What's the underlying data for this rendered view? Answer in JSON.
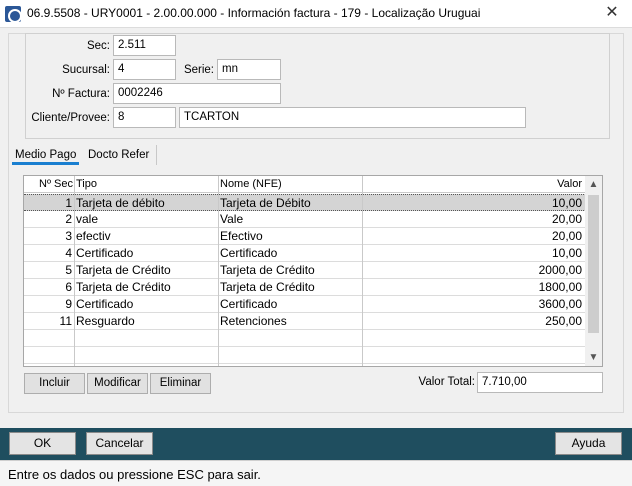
{
  "window": {
    "title": "06.9.5508 - URY0001 - 2.00.00.000 - Información factura - 179 - Localização Uruguai",
    "close_glyph": "✕"
  },
  "header": {
    "sec_label": "Sec:",
    "sec_value": "2.511",
    "sucursal_label": "Sucursal:",
    "sucursal_value": "4",
    "serie_label": "Serie:",
    "serie_value": "mn",
    "factura_label": "Nº Factura:",
    "factura_value": "0002246",
    "cliente_label": "Cliente/Provee:",
    "cliente_code": "8",
    "cliente_name": "TCARTON"
  },
  "tabs": [
    {
      "label": "Medio Pago",
      "active": true
    },
    {
      "label": "Docto Refer",
      "active": false
    }
  ],
  "grid": {
    "columns": [
      "Nº Sec",
      "Tipo",
      "Nome (NFE)",
      "Valor"
    ],
    "rows": [
      {
        "sec": "1",
        "tipo": "Tarjeta de débito",
        "nome": "Tarjeta de Débito",
        "valor": "10,00"
      },
      {
        "sec": "2",
        "tipo": "vale",
        "nome": "Vale",
        "valor": "20,00"
      },
      {
        "sec": "3",
        "tipo": "efectiv",
        "nome": "Efectivo",
        "valor": "20,00"
      },
      {
        "sec": "4",
        "tipo": "Certificado",
        "nome": "Certificado",
        "valor": "10,00"
      },
      {
        "sec": "5",
        "tipo": "Tarjeta de Crédito",
        "nome": "Tarjeta de Crédito",
        "valor": "2000,00"
      },
      {
        "sec": "6",
        "tipo": "Tarjeta de Crédito",
        "nome": "Tarjeta de Crédito",
        "valor": "1800,00"
      },
      {
        "sec": "9",
        "tipo": "Certificado",
        "nome": "Certificado",
        "valor": "3600,00"
      },
      {
        "sec": "11",
        "tipo": "Resguardo",
        "nome": "Retenciones",
        "valor": "250,00"
      }
    ],
    "scroll_up_glyph": "▲",
    "scroll_down_glyph": "▼"
  },
  "actions": {
    "incluir": "Incluir",
    "modificar": "Modificar",
    "eliminar": "Eliminar"
  },
  "total": {
    "label": "Valor Total:",
    "value": "7.710,00"
  },
  "footer": {
    "ok": "OK",
    "cancel": "Cancelar",
    "help": "Ayuda"
  },
  "status": {
    "text": "Entre os dados ou pressione ESC para sair."
  },
  "colors": {
    "footer_bar": "#1f4e5f",
    "tab_underline": "#1a7fd0",
    "selected_row": "#d4d4d4"
  }
}
